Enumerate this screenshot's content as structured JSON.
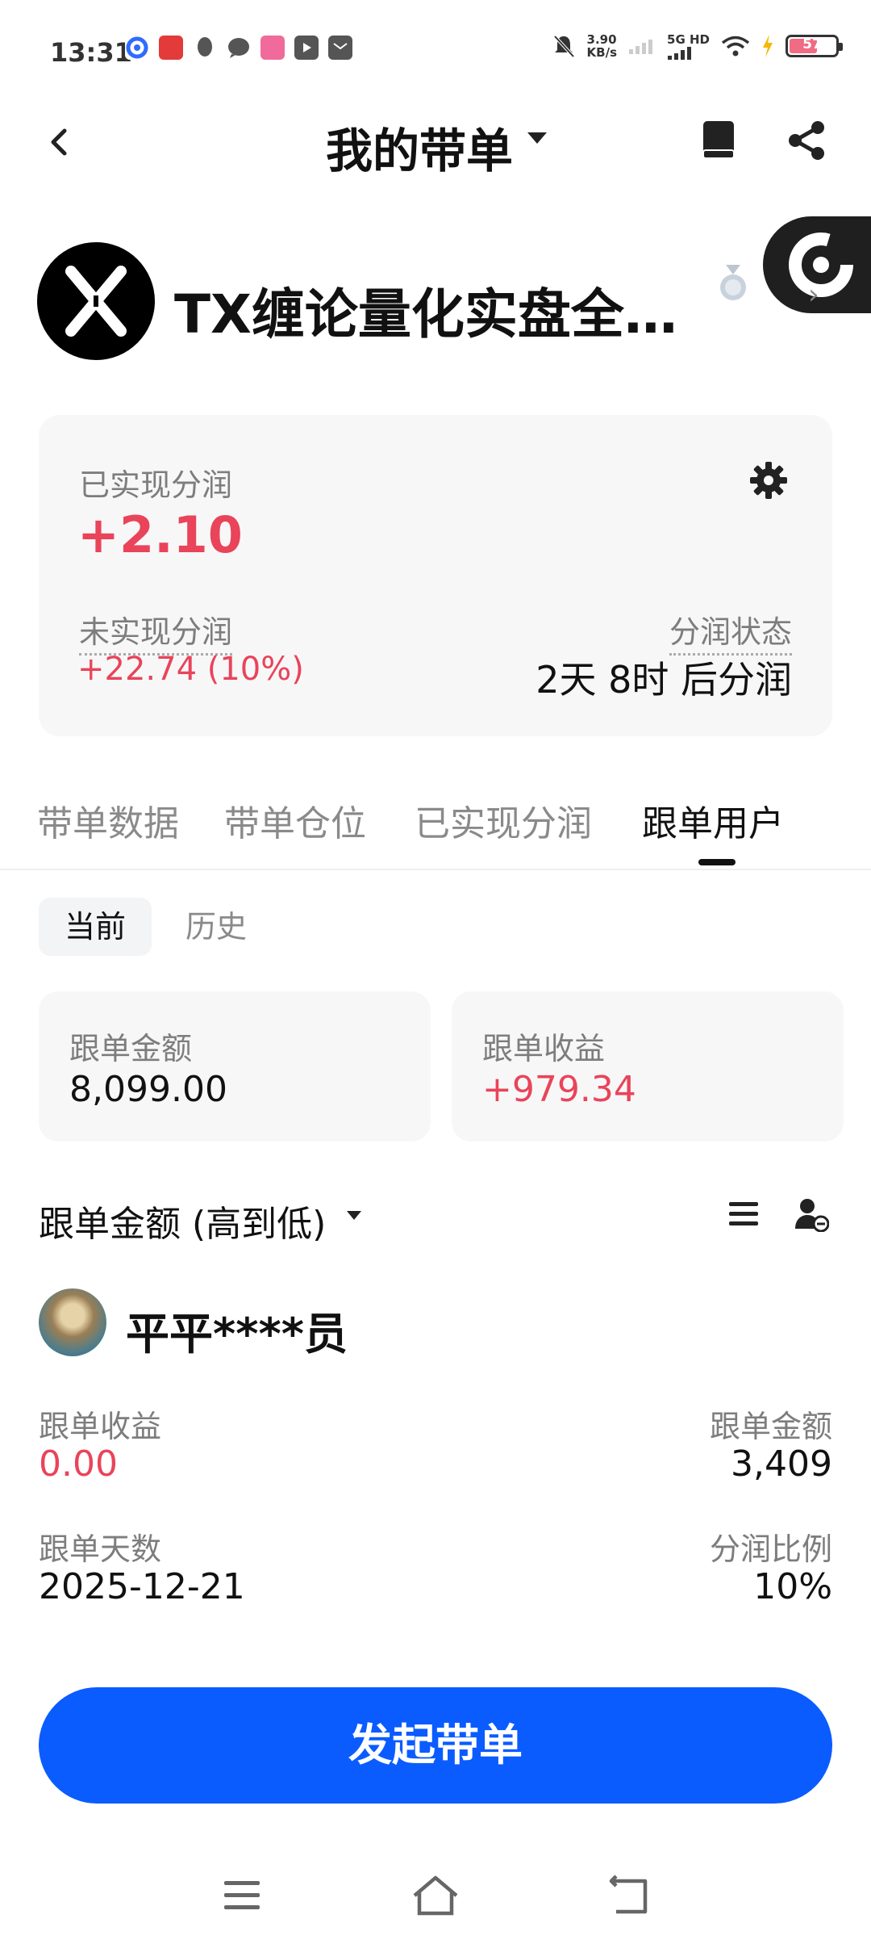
{
  "status_bar": {
    "time": "13:31",
    "net_speed_value": "3.90",
    "net_speed_unit": "KB/s",
    "network": "5G HD",
    "battery": "57"
  },
  "header": {
    "title": "我的带单"
  },
  "profile": {
    "name": "TX缠论量化实盘全…"
  },
  "summary": {
    "realized_label": "已实现分润",
    "realized_value": "+2.10",
    "unrealized_label": "未实现分润",
    "unrealized_value": "+22.74 (10%)",
    "status_label": "分润状态",
    "status_value": "2天 8时 后分润"
  },
  "tabs": [
    "带单数据",
    "带单仓位",
    "已实现分润",
    "跟单用户"
  ],
  "subtabs": {
    "current": "当前",
    "history": "历史"
  },
  "stats": {
    "amount_label": "跟单金额",
    "amount_value": "8,099.00",
    "profit_label": "跟单收益",
    "profit_value": "+979.34"
  },
  "sort": {
    "label": "跟单金额 (高到低)"
  },
  "follower": {
    "name": "平平****员",
    "profit_label": "跟单收益",
    "profit_value": "0.00",
    "amount_label": "跟单金额",
    "amount_value": "3,409",
    "days_label": "跟单天数",
    "days_value": "2025-12-21",
    "ratio_label": "分润比例",
    "ratio_value": "10%"
  },
  "action": {
    "start_label": "发起带单"
  },
  "colors": {
    "accent_red": "#e9445a",
    "primary_blue": "#0a5cff"
  }
}
